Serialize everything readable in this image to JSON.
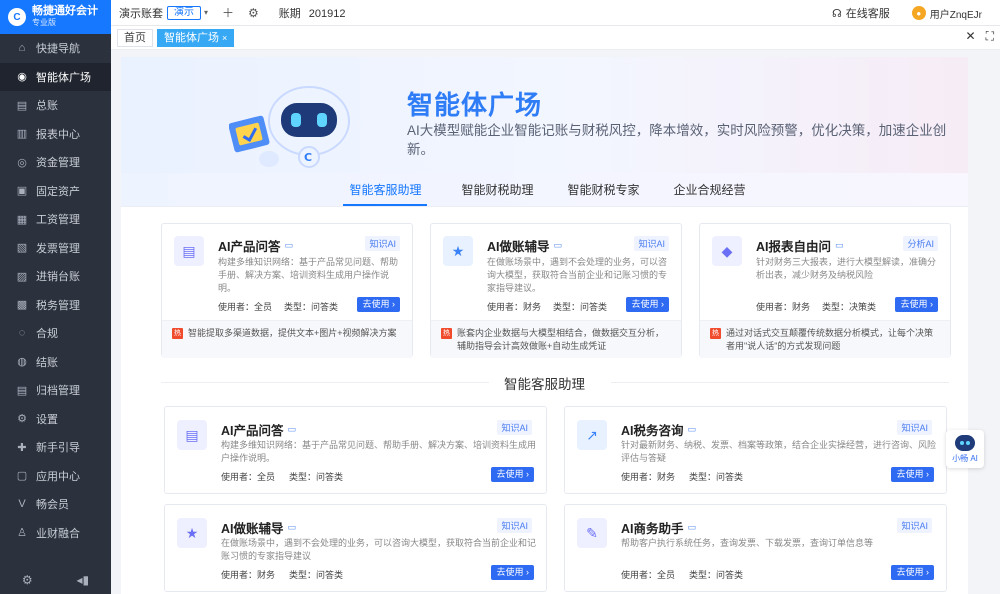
{
  "app": {
    "title": "畅捷通好会计",
    "edition": "专业版",
    "logo_mark": "C"
  },
  "sidebar": {
    "items": [
      {
        "label": "快捷导航",
        "icon": "home-icon",
        "glyph": "⌂"
      },
      {
        "label": "智能体广场",
        "icon": "ai-agent-icon",
        "glyph": "◉"
      },
      {
        "label": "总账",
        "icon": "ledger-icon",
        "glyph": "▤"
      },
      {
        "label": "报表中心",
        "icon": "chart-icon",
        "glyph": "▥"
      },
      {
        "label": "资金管理",
        "icon": "money-icon",
        "glyph": "◎"
      },
      {
        "label": "固定资产",
        "icon": "asset-icon",
        "glyph": "▣"
      },
      {
        "label": "工资管理",
        "icon": "salary-icon",
        "glyph": "▦"
      },
      {
        "label": "发票管理",
        "icon": "invoice-icon",
        "glyph": "▧"
      },
      {
        "label": "进销台账",
        "icon": "inventory-icon",
        "glyph": "▨"
      },
      {
        "label": "税务管理",
        "icon": "tax-icon",
        "glyph": "▩"
      },
      {
        "label": "合规",
        "icon": "compliance-icon",
        "glyph": "◌"
      },
      {
        "label": "结账",
        "icon": "close-books-icon",
        "glyph": "◍"
      },
      {
        "label": "归档管理",
        "icon": "archive-icon",
        "glyph": "▤"
      },
      {
        "label": "设置",
        "icon": "gear-icon",
        "glyph": "⚙"
      },
      {
        "label": "新手引导",
        "icon": "guide-icon",
        "glyph": "✚"
      },
      {
        "label": "应用中心",
        "icon": "apps-icon",
        "glyph": "▢"
      },
      {
        "label": "畅会员",
        "icon": "member-icon",
        "glyph": "V"
      },
      {
        "label": "业财融合",
        "icon": "integration-icon",
        "glyph": "♙"
      }
    ],
    "active_index": 1
  },
  "topbar": {
    "account": "演示账套",
    "demo_tag": "演示",
    "period_label": "账期",
    "period_value": "201912",
    "online_service": "在线客服",
    "user": "用户ZnqEJr"
  },
  "tabs": [
    {
      "label": "首页",
      "active": false
    },
    {
      "label": "智能体广场",
      "active": true,
      "close": "×"
    }
  ],
  "banner": {
    "title": "智能体广场",
    "desc": "AI大模型赋能企业智能记账与财税风控，降本增效，实时风险预警，优化决策，加速企业创新。"
  },
  "category_tabs": [
    "智能客服助理",
    "智能财税助理",
    "智能财税专家",
    "企业合规经营"
  ],
  "featured": [
    {
      "title": "AI产品问答",
      "tag": "知识AI",
      "icon": "chat-icon",
      "color": "purple",
      "desc": "构建多维知识网络：基于产品常见问题、帮助手册、解决方案、培训资料生成用户操作说明。",
      "user": "使用者：全员",
      "type": "类型：问答类",
      "btn": "去使用",
      "foot": "智能提取多渠道数据，提供文本+图片+视频解决方案"
    },
    {
      "title": "AI做账辅导",
      "tag": "知识AI",
      "icon": "star-icon",
      "color": "blue",
      "desc": "在做账场景中，遇到不会处理的业务，可以咨询大模型，获取符合当前企业和记账习惯的专家指导建议。",
      "user": "使用者：财务",
      "type": "类型：问答类",
      "btn": "去使用",
      "foot": "账套内企业数据与大模型相结合，做数据交互分析，辅助指导会计高效做账+自动生成凭证"
    },
    {
      "title": "AI报表自由问",
      "tag": "分析AI",
      "icon": "report-icon",
      "color": "purple",
      "desc": "针对财务三大报表，进行大模型解读，准确分析出表，减少财务及纳税风险",
      "user": "使用者：财务",
      "type": "类型：决策类",
      "btn": "去使用",
      "foot": "通过对话式交互颠覆传统数据分析模式，让每个决策者用\"说人话\"的方式发现问题"
    }
  ],
  "hot_badge": "热",
  "section_title": "智能客服助理",
  "list": [
    {
      "title": "AI产品问答",
      "tag": "知识AI",
      "icon": "chat-icon",
      "color": "purple",
      "desc": "构建多维知识网络：基于产品常见问题、帮助手册、解决方案、培训资料生成用户操作说明。",
      "user": "使用者：全员",
      "type": "类型：问答类",
      "btn": "去使用"
    },
    {
      "title": "AI税务咨询",
      "tag": "知识AI",
      "icon": "tax-chart-icon",
      "color": "blue",
      "desc": "针对最新财务、纳税、发票、档案等政策，结合企业实操经营，进行咨询、风险评估与答疑",
      "user": "使用者：财务",
      "type": "类型：问答类",
      "btn": "去使用"
    },
    {
      "title": "AI做账辅导",
      "tag": "知识AI",
      "icon": "star-icon",
      "color": "purple",
      "desc": "在做账场景中，遇到不会处理的业务，可以咨询大模型，获取符合当前企业和记账习惯的专家指导建议",
      "user": "使用者：财务",
      "type": "类型：问答类",
      "btn": "去使用"
    },
    {
      "title": "AI商务助手",
      "tag": "知识AI",
      "icon": "edit-icon",
      "color": "purple",
      "desc": "帮助客户执行系统任务，查询发票、下载发票，查询订单信息等",
      "user": "使用者：全员",
      "type": "类型：问答类",
      "btn": "去使用"
    }
  ],
  "assistant": {
    "label": "小畅 AI"
  },
  "colors": {
    "accent": "#1677ff",
    "sidebar": "#2b313d",
    "button": "#2f6bf2"
  }
}
